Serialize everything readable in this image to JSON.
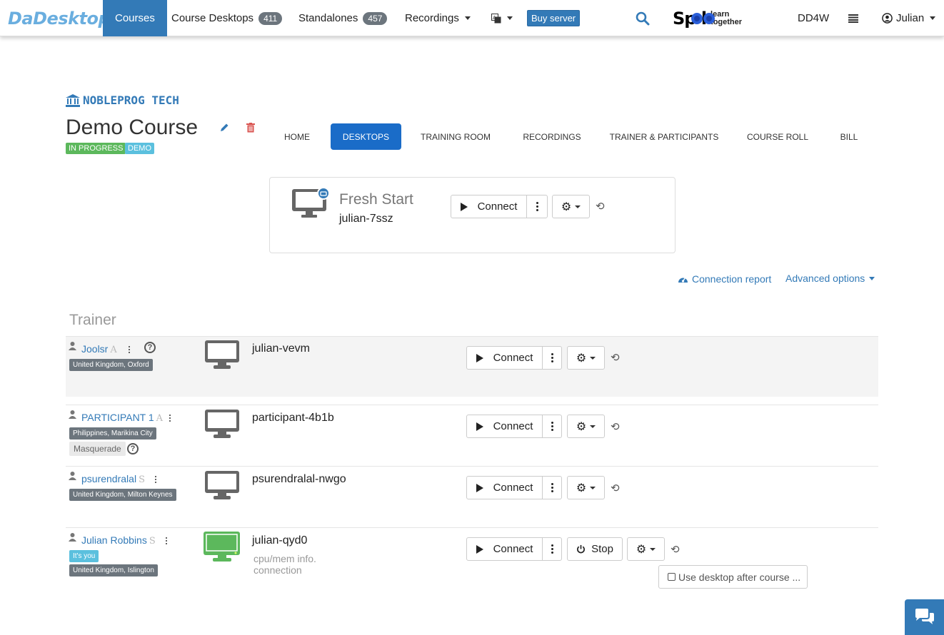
{
  "nav": {
    "brand": "DaDesktop",
    "items": [
      {
        "label": "Courses"
      },
      {
        "label": "Course Desktops",
        "count": "411"
      },
      {
        "label": "Standalones",
        "count": "457"
      },
      {
        "label": "Recordings"
      }
    ],
    "buy_server": "Buy server",
    "spool": "Sp  l",
    "spool_tagline_1": "learn",
    "spool_tagline_2": "together",
    "region": "DD4W",
    "user": "Julian"
  },
  "course": {
    "org": "NOBLEPROG TECH",
    "title": "Demo Course",
    "badges": [
      {
        "label": "IN PROGRESS",
        "color": "#5cb85c"
      },
      {
        "label": "DEMO",
        "color": "#5bc0de"
      }
    ]
  },
  "tabs": [
    "HOME",
    "DESKTOPS",
    "TRAINING ROOM",
    "RECORDINGS",
    "TRAINER & PARTICIPANTS",
    "COURSE ROLL",
    "BILL"
  ],
  "fresh_start": {
    "title": "Fresh Start",
    "host": "julian-7ssz",
    "connect": "Connect"
  },
  "links": {
    "connection_report": "Connection report",
    "advanced_options": "Advanced options"
  },
  "section": {
    "trainer": "Trainer"
  },
  "rows": [
    {
      "name": "Joolsr",
      "role": "A",
      "location": "United Kingdom, Oxford",
      "host": "julian-vevm",
      "connect": "Connect"
    },
    {
      "name": "PARTICIPANT 1",
      "role": "A",
      "location": "Philippines, Marikina City",
      "masquerade": "Masquerade",
      "host": "participant-4b1b",
      "connect": "Connect"
    },
    {
      "name": "psurendralal",
      "role": "S",
      "location": "United Kingdom, Milton Keynes",
      "host": "psurendralal-nwgo",
      "connect": "Connect"
    },
    {
      "name": "Julian Robbins",
      "role": "S",
      "you": "It's you",
      "location": "United Kingdom, Islington",
      "host": "julian-qyd0",
      "info": "cpu/mem info.",
      "connection": "connection",
      "connect": "Connect",
      "stop": "Stop",
      "use_after": "Use desktop after course ..."
    }
  ],
  "colors": {
    "primary": "#337ab7",
    "active_tab": "#1a6cc8",
    "running_monitor": "#5cb85c",
    "idle_monitor": "#666666"
  }
}
